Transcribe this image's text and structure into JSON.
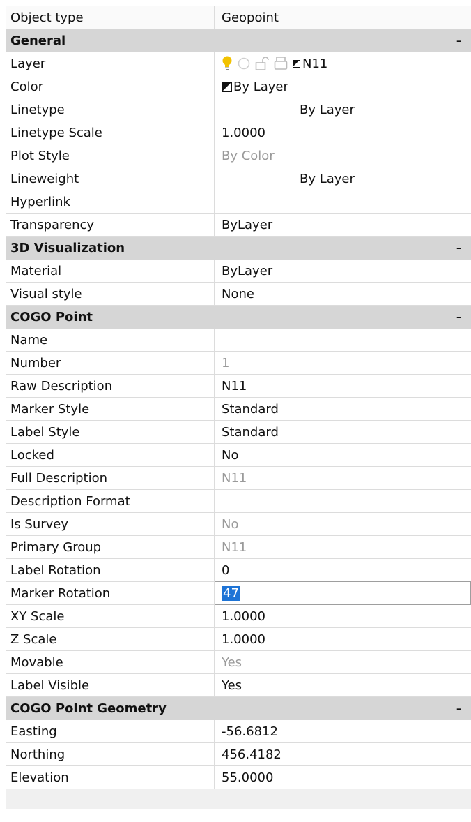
{
  "header": {
    "label": "Object type",
    "value": "Geopoint"
  },
  "sections": {
    "general": {
      "title": "General",
      "toggle": "-",
      "layer": {
        "label": "Layer",
        "value": "N11"
      },
      "color": {
        "label": "Color",
        "value": "By Layer"
      },
      "linetype": {
        "label": "Linetype",
        "value": "By Layer"
      },
      "linetype_scale": {
        "label": "Linetype Scale",
        "value": "1.0000"
      },
      "plot_style": {
        "label": "Plot Style",
        "value": "By Color"
      },
      "lineweight": {
        "label": "Lineweight",
        "value": "By Layer"
      },
      "hyperlink": {
        "label": "Hyperlink",
        "value": ""
      },
      "transparency": {
        "label": "Transparency",
        "value": "ByLayer"
      }
    },
    "visualization": {
      "title": "3D Visualization",
      "toggle": "-",
      "material": {
        "label": "Material",
        "value": "ByLayer"
      },
      "visual_style": {
        "label": "Visual style",
        "value": "None"
      }
    },
    "cogo": {
      "title": "COGO Point",
      "toggle": "-",
      "name": {
        "label": "Name",
        "value": ""
      },
      "number": {
        "label": "Number",
        "value": "1"
      },
      "raw_description": {
        "label": "Raw Description",
        "value": "N11"
      },
      "marker_style": {
        "label": "Marker Style",
        "value": "Standard"
      },
      "label_style": {
        "label": "Label Style",
        "value": "Standard"
      },
      "locked": {
        "label": "Locked",
        "value": "No"
      },
      "full_description": {
        "label": "Full Description",
        "value": "N11"
      },
      "description_format": {
        "label": "Description Format",
        "value": ""
      },
      "is_survey": {
        "label": "Is Survey",
        "value": "No"
      },
      "primary_group": {
        "label": "Primary Group",
        "value": "N11"
      },
      "label_rotation": {
        "label": "Label Rotation",
        "value": "0"
      },
      "marker_rotation": {
        "label": "Marker Rotation",
        "value": "47"
      },
      "xy_scale": {
        "label": "XY Scale",
        "value": "1.0000"
      },
      "z_scale": {
        "label": "Z Scale",
        "value": "1.0000"
      },
      "movable": {
        "label": "Movable",
        "value": "Yes"
      },
      "label_visible": {
        "label": "Label Visible",
        "value": "Yes"
      }
    },
    "geometry": {
      "title": "COGO Point Geometry",
      "toggle": "-",
      "easting": {
        "label": "Easting",
        "value": "-56.6812"
      },
      "northing": {
        "label": "Northing",
        "value": "456.4182"
      },
      "elevation": {
        "label": "Elevation",
        "value": "55.0000"
      }
    }
  },
  "colors": {
    "section_bg": "#d6d6d6",
    "selection": "#1e74d6",
    "disabled_text": "#9a9a9a",
    "bulb": "#f2c200"
  },
  "icons": [
    "lightbulb-icon",
    "circle-icon",
    "padlock-icon",
    "printer-icon",
    "color-swatch-icon"
  ]
}
